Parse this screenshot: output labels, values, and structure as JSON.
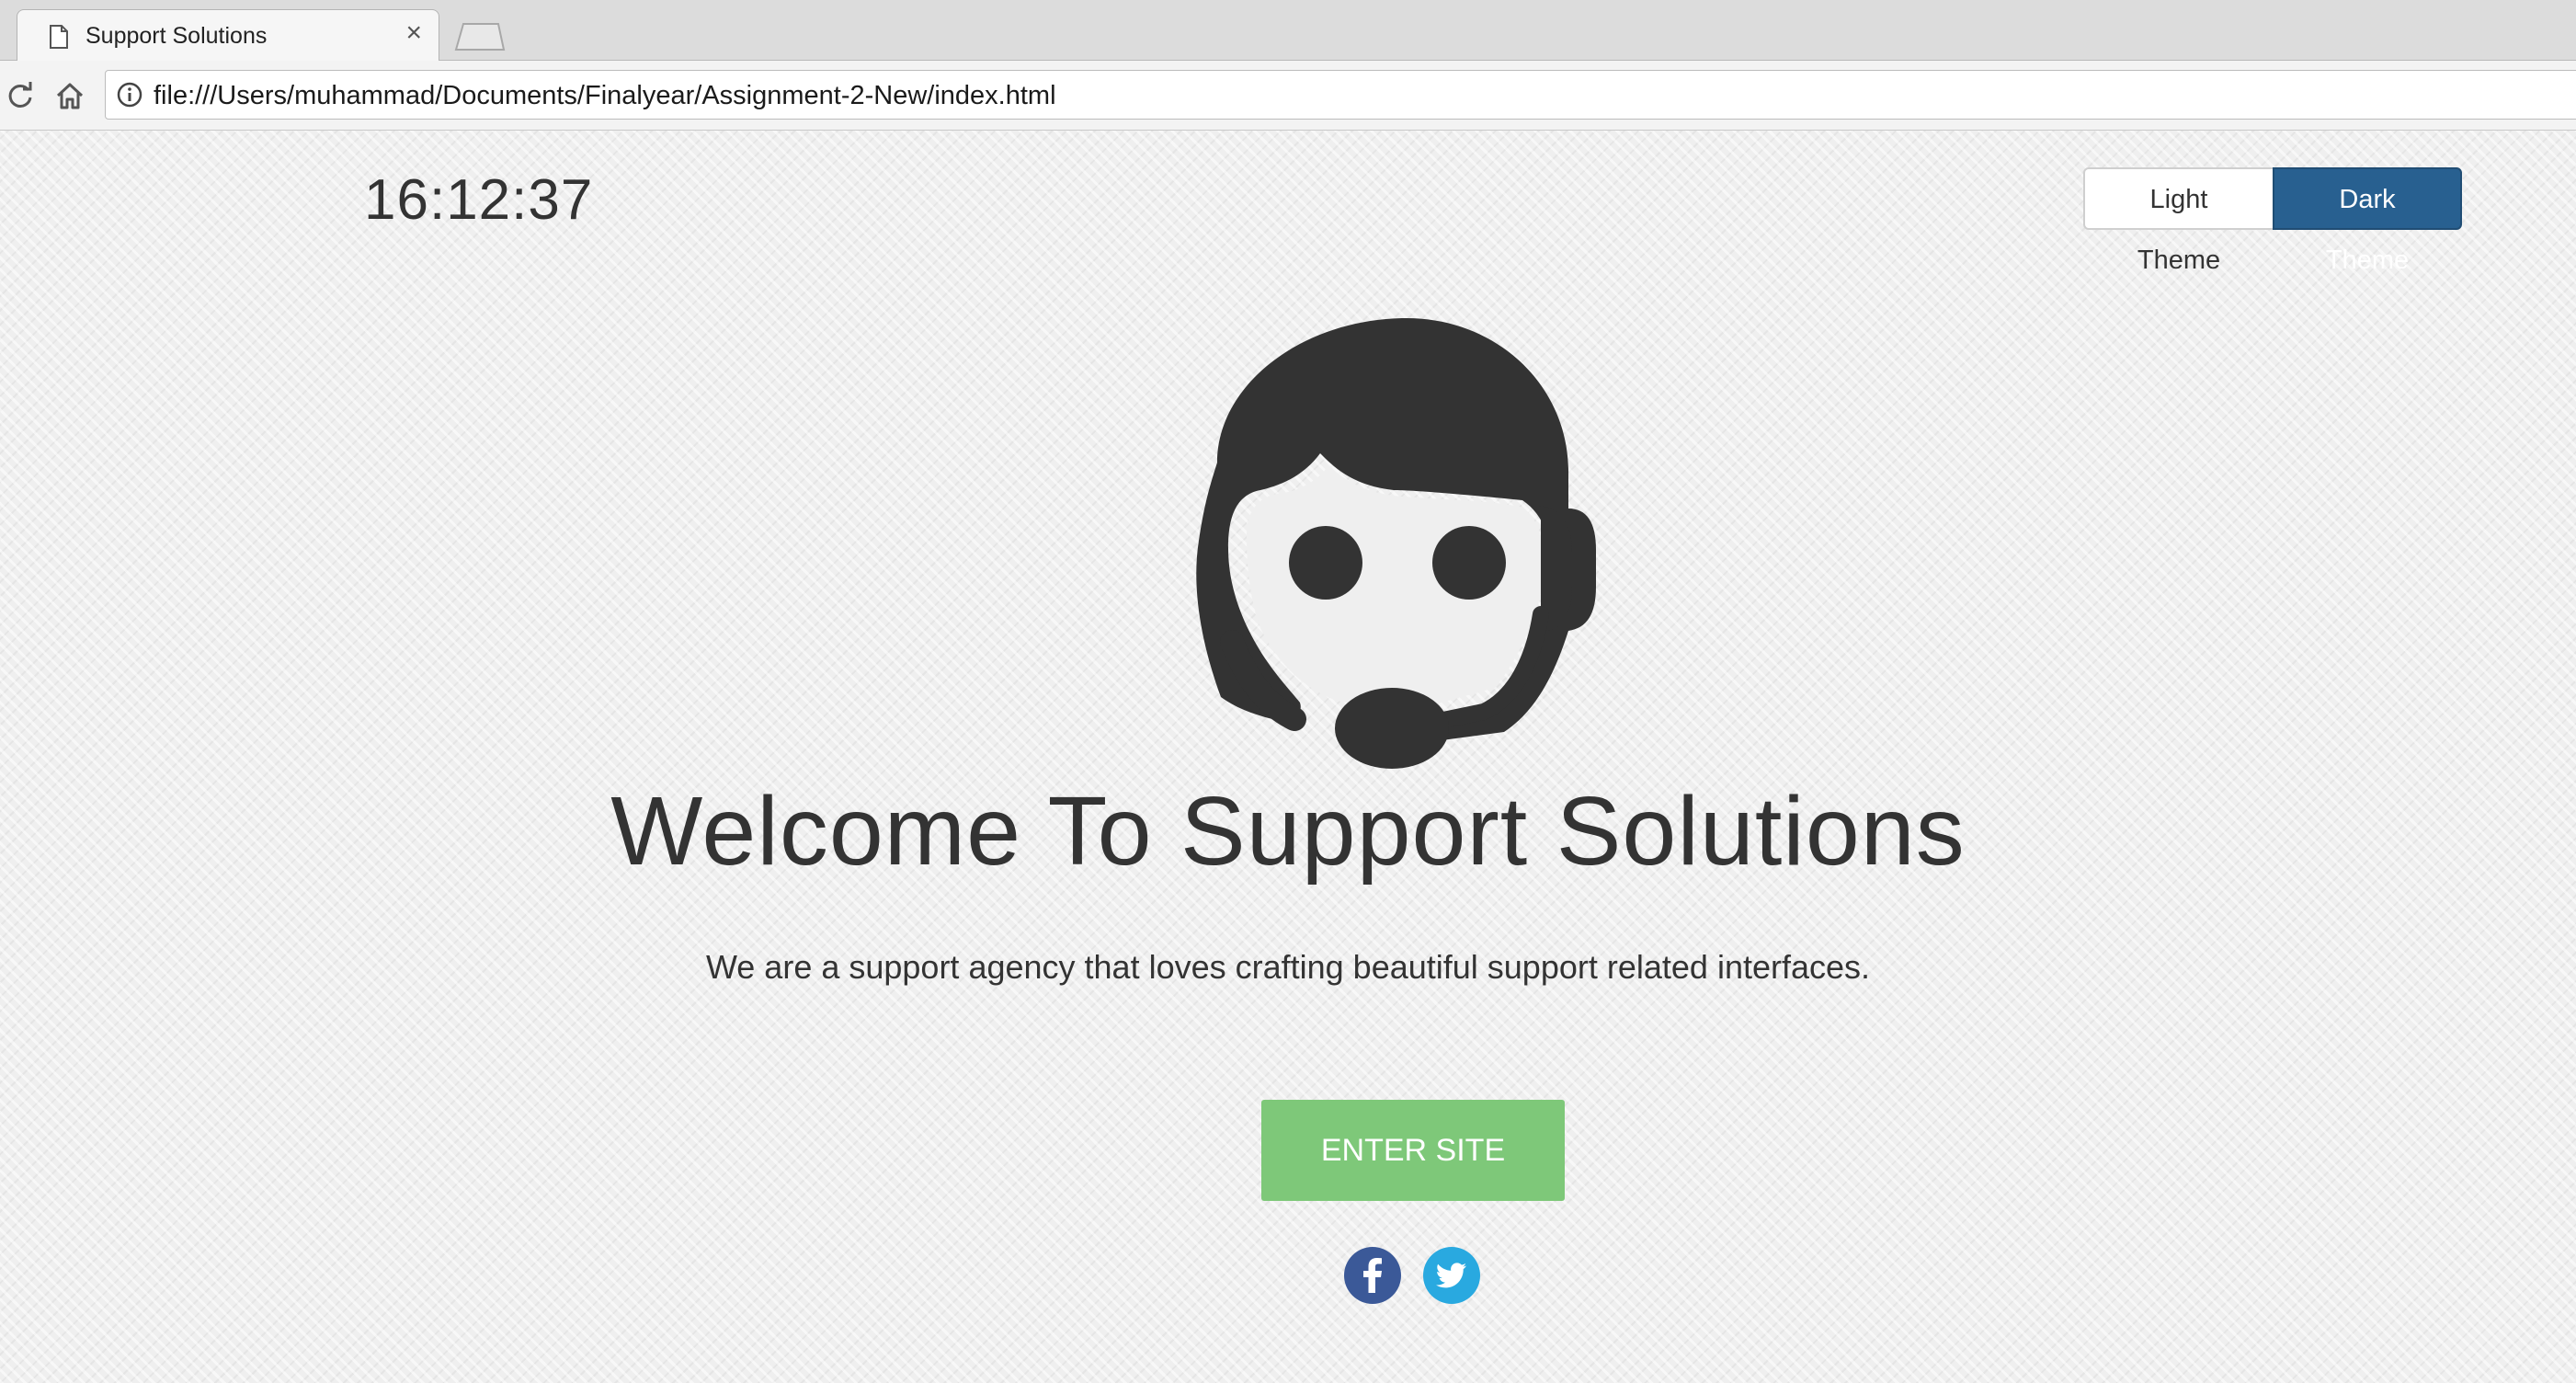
{
  "browser": {
    "tab_title": "Support Solutions",
    "tab_close_glyph": "×",
    "url": "file:///Users/muhammad/Documents/Finalyear/Assignment-2-New/index.html",
    "icons": [
      "page-icon",
      "close-icon",
      "reload-icon",
      "home-icon",
      "info-icon"
    ]
  },
  "page": {
    "clock": "16:12:37",
    "theme_switcher": {
      "light_label": "Light Theme",
      "dark_label": "Dark Theme",
      "active": "Dark Theme"
    },
    "hero_icon": "customer-support-headset-icon",
    "headline": "Welcome To Support Solutions",
    "tagline": "We are a support agency that loves crafting beautiful support related interfaces.",
    "enter_button_label": "ENTER SITE",
    "social_links": [
      {
        "name": "facebook-icon",
        "color": "#3b5998"
      },
      {
        "name": "twitter-icon",
        "color": "#29a9e0"
      }
    ]
  },
  "colors": {
    "text": "#333333",
    "dark_theme_button": "#286090",
    "enter_button": "#7ec879"
  }
}
